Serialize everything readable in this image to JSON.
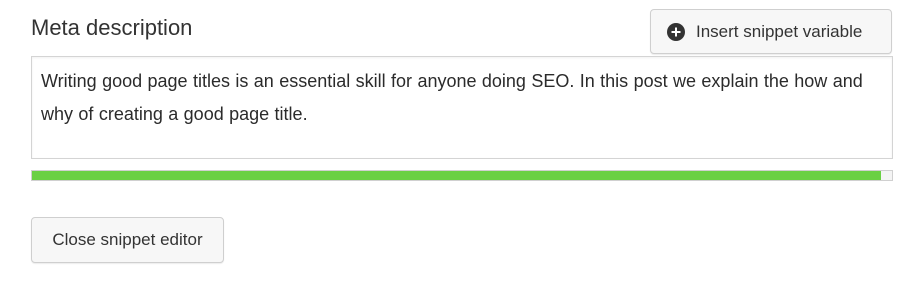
{
  "meta_description": {
    "label": "Meta description",
    "insert_button_label": "Insert snippet variable",
    "insert_button_icon": "plus-circle-icon",
    "value": "Writing good page titles is an essential skill for anyone doing SEO. In this post we explain the how and why of creating a good page title.",
    "progress": {
      "fraction": 0.987,
      "color": "#6ad044"
    }
  },
  "close_button_label": "Close snippet editor"
}
